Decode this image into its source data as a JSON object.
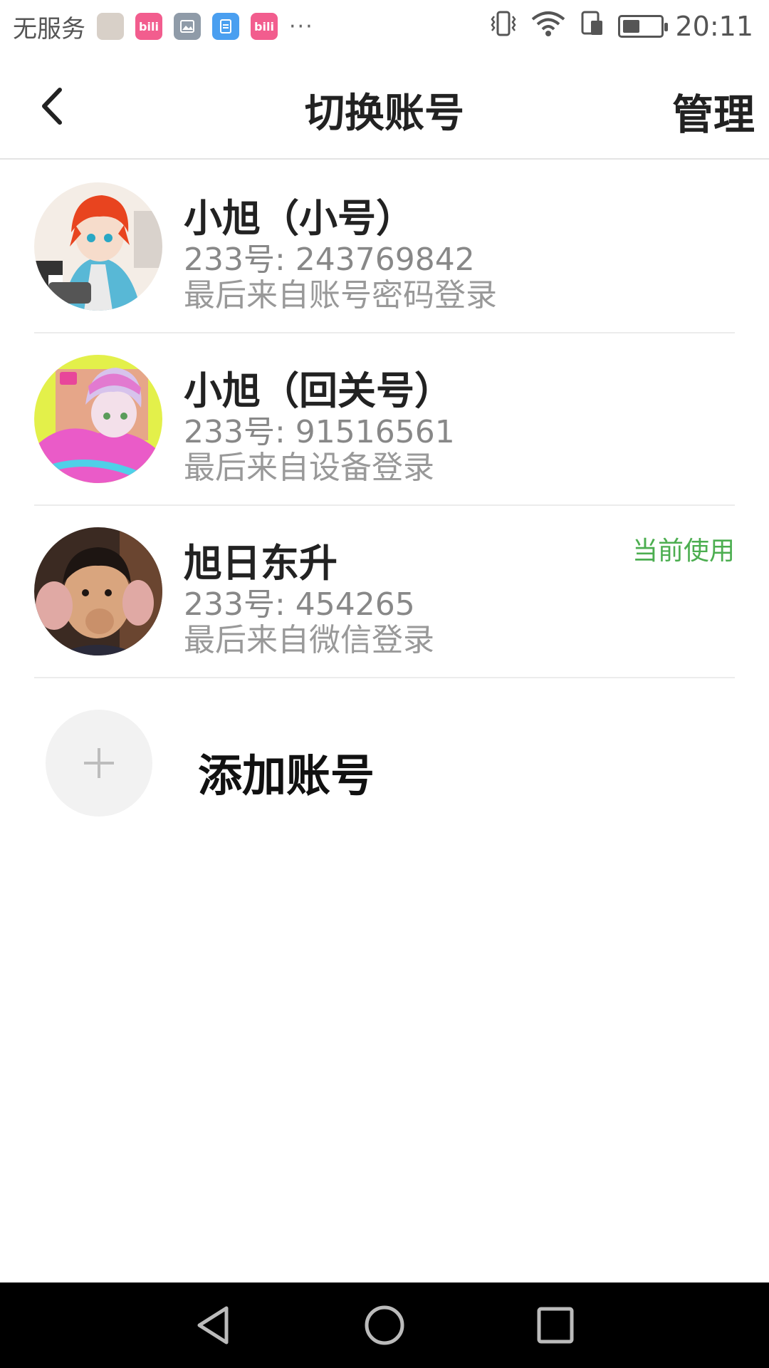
{
  "status_bar": {
    "carrier": "无服务",
    "time": "20:11",
    "more": "···",
    "notifications": [
      {
        "icon": "photo-app-icon",
        "color": "#d8d0c8",
        "text": ""
      },
      {
        "icon": "bilibili-icon",
        "color": "#f25d8e",
        "text": "bili"
      },
      {
        "icon": "gallery-icon",
        "color": "#8f9ba8",
        "text": ""
      },
      {
        "icon": "file-icon",
        "color": "#4a9ff0",
        "text": ""
      },
      {
        "icon": "bilibili-icon",
        "color": "#f25d8e",
        "text": "bili"
      }
    ],
    "battery_level": 0.45
  },
  "header": {
    "title": "切换账号",
    "manage_label": "管理"
  },
  "accounts": [
    {
      "name": "小旭（小号）",
      "id_line": "233号: 243769842",
      "login": "最后来自账号密码登录",
      "current": "",
      "avatar_colors": [
        "#e8441f",
        "#58b8d6",
        "#f4ede6"
      ]
    },
    {
      "name": "小旭（回关号）",
      "id_line": "233号: 91516561",
      "login": "最后来自设备登录",
      "current": "",
      "avatar_colors": [
        "#e3f04a",
        "#ea5bc8",
        "#e8d9f0"
      ]
    },
    {
      "name": "旭日东升",
      "id_line": "233号: 454265",
      "login": "最后来自微信登录",
      "current": "当前使用",
      "avatar_colors": [
        "#3b2a22",
        "#e0a9a4",
        "#c9a07e"
      ]
    }
  ],
  "add_account": {
    "label": "添加账号"
  }
}
